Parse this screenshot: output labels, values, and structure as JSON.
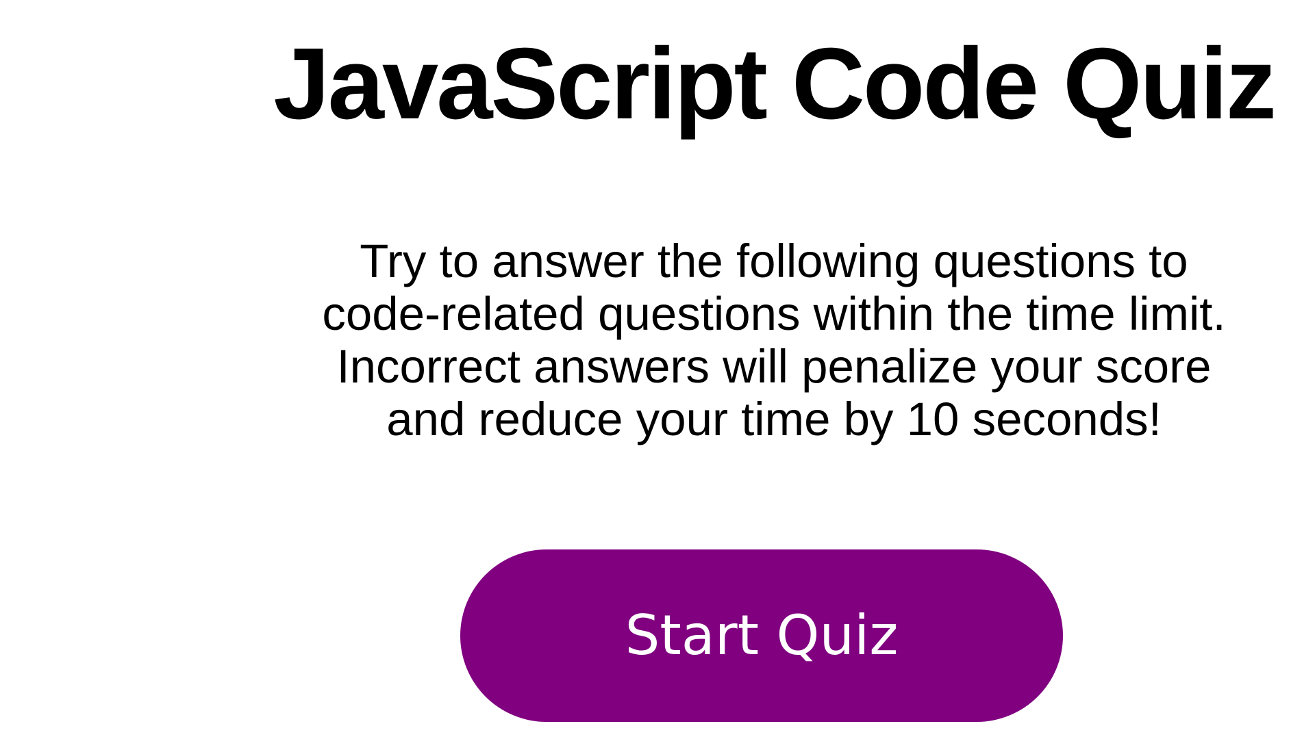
{
  "quiz": {
    "title": "JavaScript Code Quiz",
    "intro_lines": [
      "Try to answer the following questions to",
      "code-related questions within the time limit.",
      "Incorrect answers will penalize your score",
      "and reduce your time by 10 seconds!"
    ],
    "start_label": "Start Quiz"
  },
  "colors": {
    "button_bg": "#800080",
    "button_text": "#ffffff",
    "text": "#000000"
  }
}
